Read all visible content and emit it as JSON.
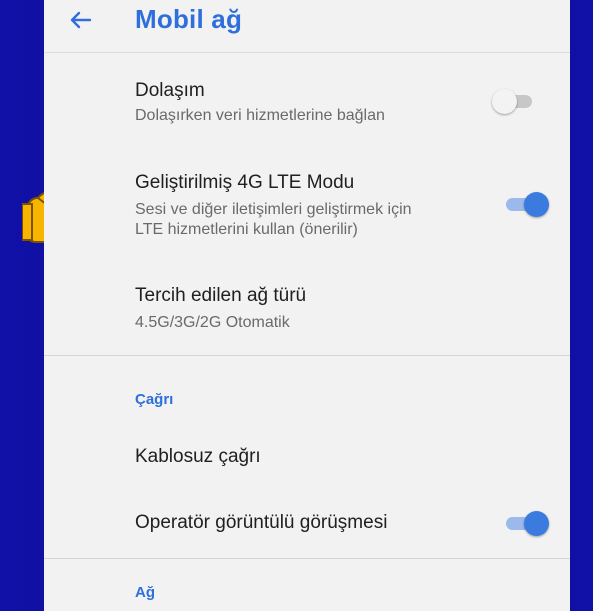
{
  "appbar": {
    "title": "Mobil ağ",
    "back_icon": "arrow-left-icon"
  },
  "colors": {
    "accent": "#2f6fdb",
    "toggle_on": "#3b7be0",
    "background_frame": "#0d0d9e"
  },
  "settings": {
    "roaming": {
      "title": "Dolaşım",
      "subtitle": "Dolaşırken veri hizmetlerine bağlan",
      "enabled": false
    },
    "lte": {
      "title": "Geliştirilmiş 4G LTE Modu",
      "subtitle_line1": "Sesi ve diğer iletişimleri geliştirmek için",
      "subtitle_line2": "LTE hizmetlerini kullan (önerilir)",
      "enabled": true
    },
    "network_type": {
      "title": "Tercih edilen ağ türü",
      "subtitle": "4.5G/3G/2G Otomatik"
    }
  },
  "call_section": {
    "header": "Çağrı",
    "wifi_calling": {
      "title": "Kablosuz çağrı"
    },
    "video_call": {
      "title": "Operatör görüntülü görüşmesi",
      "enabled": true
    }
  },
  "network_section": {
    "header": "Ağ"
  },
  "pointer": {
    "icon": "pointing-hand-icon"
  }
}
